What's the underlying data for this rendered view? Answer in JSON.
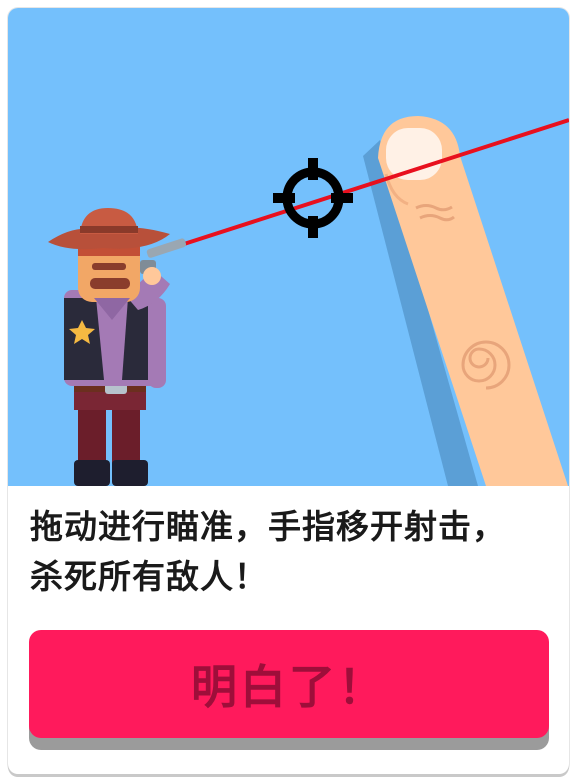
{
  "dialog": {
    "instruction_line1": "拖动进行瞄准，手指移开射击，",
    "instruction_line2": "杀死所有敌人！",
    "confirm_label": "明白了！"
  },
  "illustration": {
    "background_color": "#74c0fc",
    "icons": [
      "cowboy-enemy",
      "revolver-icon",
      "crosshair-icon",
      "finger-icon",
      "aim-laser-line"
    ]
  },
  "colors": {
    "button": "#ff1a5c",
    "button_text": "#9e0e3a",
    "laser": "#e8101e"
  }
}
